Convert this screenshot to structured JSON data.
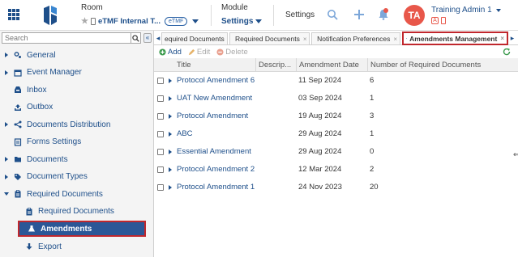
{
  "header": {
    "room_label": "Room",
    "room_value": "eTMF Internal T...",
    "room_badge": "eTMF",
    "module_label": "Module",
    "module_value": "Settings",
    "page_label": "Settings",
    "avatar_initials": "TA",
    "user_name": "Training Admin 1",
    "user_badge": "A",
    "icons": [
      "apps-grid-icon",
      "logo-icon",
      "star-icon",
      "mobile-icon",
      "search-icon",
      "plus-icon",
      "bell-icon",
      "chevron-down-icon"
    ],
    "colors": {
      "brand": "#1e4f8a",
      "avatar": "#e8574a",
      "highlight": "#c0272d"
    }
  },
  "sidebar": {
    "search_placeholder": "Search",
    "collapse_label": "«",
    "items": [
      {
        "label": "General",
        "icon": "gears-icon"
      },
      {
        "label": "Event Manager",
        "icon": "calendar-icon"
      },
      {
        "label": "Inbox",
        "icon": "inbox-icon"
      },
      {
        "label": "Outbox",
        "icon": "outbox-icon"
      },
      {
        "label": "Documents Distribution",
        "icon": "share-icon"
      },
      {
        "label": "Forms Settings",
        "icon": "form-icon"
      },
      {
        "label": "Documents",
        "icon": "folder-icon"
      },
      {
        "label": "Document Types",
        "icon": "tag-icon"
      },
      {
        "label": "Required Documents",
        "icon": "clipboard-icon"
      },
      {
        "label": "Required Documents",
        "icon": "clipboard-icon"
      },
      {
        "label": "Amendments",
        "icon": "flask-icon"
      },
      {
        "label": "Export",
        "icon": "download-icon"
      }
    ]
  },
  "tabs": {
    "prev": "◂",
    "next": "▸",
    "items": [
      {
        "label": "equired Documents"
      },
      {
        "label": "Required Documents"
      },
      {
        "label": "Notification Preferences"
      },
      {
        "label": "Amendments Management"
      }
    ],
    "close": "×"
  },
  "toolbar": {
    "add": "Add",
    "edit": "Edit",
    "delete": "Delete"
  },
  "grid": {
    "columns": [
      "Title",
      "Descrip...",
      "Amendment Date",
      "Number of Required Documents"
    ],
    "rows": [
      {
        "title": "Protocol Amendment 6",
        "description": "",
        "date": "11 Sep 2024",
        "count": "6"
      },
      {
        "title": "UAT New Amendment",
        "description": "",
        "date": "03 Sep 2024",
        "count": "1"
      },
      {
        "title": "Protocol Amendment",
        "description": "",
        "date": "19 Aug 2024",
        "count": "3"
      },
      {
        "title": "ABC",
        "description": "",
        "date": "29 Aug 2024",
        "count": "1"
      },
      {
        "title": "Essential Amendment",
        "description": "",
        "date": "29 Aug 2024",
        "count": "0"
      },
      {
        "title": "Protocol Amendment 2",
        "description": "",
        "date": "12 Mar 2024",
        "count": "2"
      },
      {
        "title": "Protocol Amendment 1",
        "description": "",
        "date": "24 Nov 2023",
        "count": "20"
      }
    ]
  }
}
